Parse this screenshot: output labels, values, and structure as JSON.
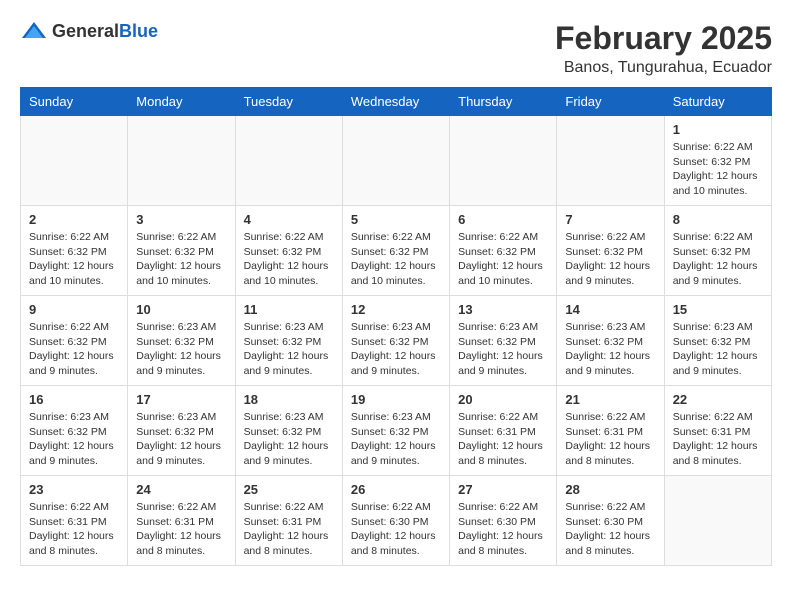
{
  "header": {
    "logo_general": "General",
    "logo_blue": "Blue",
    "month": "February 2025",
    "location": "Banos, Tungurahua, Ecuador"
  },
  "weekdays": [
    "Sunday",
    "Monday",
    "Tuesday",
    "Wednesday",
    "Thursday",
    "Friday",
    "Saturday"
  ],
  "weeks": [
    [
      {
        "day": "",
        "info": ""
      },
      {
        "day": "",
        "info": ""
      },
      {
        "day": "",
        "info": ""
      },
      {
        "day": "",
        "info": ""
      },
      {
        "day": "",
        "info": ""
      },
      {
        "day": "",
        "info": ""
      },
      {
        "day": "1",
        "info": "Sunrise: 6:22 AM\nSunset: 6:32 PM\nDaylight: 12 hours\nand 10 minutes."
      }
    ],
    [
      {
        "day": "2",
        "info": "Sunrise: 6:22 AM\nSunset: 6:32 PM\nDaylight: 12 hours\nand 10 minutes."
      },
      {
        "day": "3",
        "info": "Sunrise: 6:22 AM\nSunset: 6:32 PM\nDaylight: 12 hours\nand 10 minutes."
      },
      {
        "day": "4",
        "info": "Sunrise: 6:22 AM\nSunset: 6:32 PM\nDaylight: 12 hours\nand 10 minutes."
      },
      {
        "day": "5",
        "info": "Sunrise: 6:22 AM\nSunset: 6:32 PM\nDaylight: 12 hours\nand 10 minutes."
      },
      {
        "day": "6",
        "info": "Sunrise: 6:22 AM\nSunset: 6:32 PM\nDaylight: 12 hours\nand 10 minutes."
      },
      {
        "day": "7",
        "info": "Sunrise: 6:22 AM\nSunset: 6:32 PM\nDaylight: 12 hours\nand 9 minutes."
      },
      {
        "day": "8",
        "info": "Sunrise: 6:22 AM\nSunset: 6:32 PM\nDaylight: 12 hours\nand 9 minutes."
      }
    ],
    [
      {
        "day": "9",
        "info": "Sunrise: 6:22 AM\nSunset: 6:32 PM\nDaylight: 12 hours\nand 9 minutes."
      },
      {
        "day": "10",
        "info": "Sunrise: 6:23 AM\nSunset: 6:32 PM\nDaylight: 12 hours\nand 9 minutes."
      },
      {
        "day": "11",
        "info": "Sunrise: 6:23 AM\nSunset: 6:32 PM\nDaylight: 12 hours\nand 9 minutes."
      },
      {
        "day": "12",
        "info": "Sunrise: 6:23 AM\nSunset: 6:32 PM\nDaylight: 12 hours\nand 9 minutes."
      },
      {
        "day": "13",
        "info": "Sunrise: 6:23 AM\nSunset: 6:32 PM\nDaylight: 12 hours\nand 9 minutes."
      },
      {
        "day": "14",
        "info": "Sunrise: 6:23 AM\nSunset: 6:32 PM\nDaylight: 12 hours\nand 9 minutes."
      },
      {
        "day": "15",
        "info": "Sunrise: 6:23 AM\nSunset: 6:32 PM\nDaylight: 12 hours\nand 9 minutes."
      }
    ],
    [
      {
        "day": "16",
        "info": "Sunrise: 6:23 AM\nSunset: 6:32 PM\nDaylight: 12 hours\nand 9 minutes."
      },
      {
        "day": "17",
        "info": "Sunrise: 6:23 AM\nSunset: 6:32 PM\nDaylight: 12 hours\nand 9 minutes."
      },
      {
        "day": "18",
        "info": "Sunrise: 6:23 AM\nSunset: 6:32 PM\nDaylight: 12 hours\nand 9 minutes."
      },
      {
        "day": "19",
        "info": "Sunrise: 6:23 AM\nSunset: 6:32 PM\nDaylight: 12 hours\nand 9 minutes."
      },
      {
        "day": "20",
        "info": "Sunrise: 6:22 AM\nSunset: 6:31 PM\nDaylight: 12 hours\nand 8 minutes."
      },
      {
        "day": "21",
        "info": "Sunrise: 6:22 AM\nSunset: 6:31 PM\nDaylight: 12 hours\nand 8 minutes."
      },
      {
        "day": "22",
        "info": "Sunrise: 6:22 AM\nSunset: 6:31 PM\nDaylight: 12 hours\nand 8 minutes."
      }
    ],
    [
      {
        "day": "23",
        "info": "Sunrise: 6:22 AM\nSunset: 6:31 PM\nDaylight: 12 hours\nand 8 minutes."
      },
      {
        "day": "24",
        "info": "Sunrise: 6:22 AM\nSunset: 6:31 PM\nDaylight: 12 hours\nand 8 minutes."
      },
      {
        "day": "25",
        "info": "Sunrise: 6:22 AM\nSunset: 6:31 PM\nDaylight: 12 hours\nand 8 minutes."
      },
      {
        "day": "26",
        "info": "Sunrise: 6:22 AM\nSunset: 6:30 PM\nDaylight: 12 hours\nand 8 minutes."
      },
      {
        "day": "27",
        "info": "Sunrise: 6:22 AM\nSunset: 6:30 PM\nDaylight: 12 hours\nand 8 minutes."
      },
      {
        "day": "28",
        "info": "Sunrise: 6:22 AM\nSunset: 6:30 PM\nDaylight: 12 hours\nand 8 minutes."
      },
      {
        "day": "",
        "info": ""
      }
    ]
  ]
}
